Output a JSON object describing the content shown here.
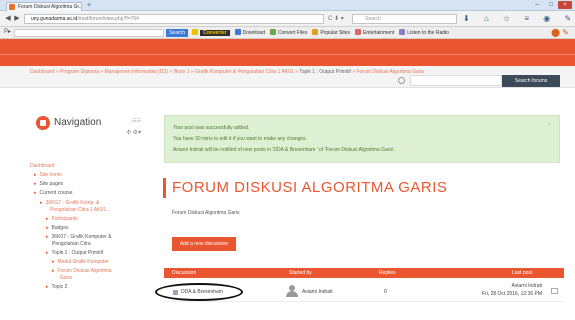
{
  "browser": {
    "tab_title": "Forum Diskusi Algoritma G...",
    "url_prefix": "uny.gunadarma.ac.id",
    "url_rest": "/mod/forum/view.php?f=764",
    "search_placeholder": "Search",
    "addon_search": "Search",
    "addon_items": [
      {
        "label": "Converter",
        "color": "#f2c200"
      },
      {
        "label": "Download",
        "color": "#3a7bd5"
      },
      {
        "label": "Convert Files",
        "color": "#6aa84f"
      },
      {
        "label": "Popular Sites",
        "color": "#e0a020"
      },
      {
        "label": "Entertainment",
        "color": "#e06666"
      },
      {
        "label": "Listen to the Radio",
        "color": "#8e7cc3"
      }
    ]
  },
  "breadcrumb": {
    "items": [
      "Dashboard",
      "Program Diploma",
      "Manajemen Informatika (D3)",
      "Ilkom 1",
      "Grafik Komputer & Pengolahan Citra 1 AK01"
    ],
    "current": "Topik 1 : Output Primitif",
    "tail": "Forum Diskusi Algoritma Garis"
  },
  "search_forums_button": "Search forums",
  "navigation": {
    "title": "Navigation",
    "tree": [
      {
        "label": "Dashboard",
        "style": "or",
        "bullet": false
      },
      {
        "label": "Site home",
        "style": "or",
        "bullet": true
      },
      {
        "label": "Site pages",
        "style": "gr",
        "bullet": true
      },
      {
        "label": "Current course",
        "style": "gr",
        "bullet": true
      },
      {
        "label": "36KG7 - Grafik Komp. &",
        "style": "or",
        "bullet": true
      },
      {
        "label": "Pengolahan Citra 1 AK01...",
        "style": "or",
        "bullet": false
      },
      {
        "label": "Participants",
        "style": "or",
        "bullet": true
      },
      {
        "label": "Badges",
        "style": "gr",
        "bullet": true
      },
      {
        "label": "36K07 - Grafik Komputer &",
        "style": "gr",
        "bullet": true
      },
      {
        "label": "Pengolahan Citra",
        "style": "gr",
        "bullet": false
      },
      {
        "label": "Topik 1 : Output Primitif",
        "style": "gr",
        "bullet": true
      },
      {
        "label": "Modul Grafik Komputer",
        "style": "or",
        "bullet": true
      },
      {
        "label": "Forum Diskusi Algoritma",
        "style": "or",
        "bullet": true
      },
      {
        "label": "Garis",
        "style": "or",
        "bullet": false
      },
      {
        "label": "Topic 2",
        "style": "gr",
        "bullet": true
      }
    ]
  },
  "alert": {
    "line1": "Your post was successfully added.",
    "line2": "You have 30 mins to edit it if you want to make any changes.",
    "line3": "Aviarni Indrati will be notified of new posts in 'DDA & Bresenham ' of 'Forum Diskusi Algoritma Garis'."
  },
  "forum": {
    "title": "FORUM DISKUSI ALGORITMA GARIS",
    "intro": "Forum Diskusi Algoritma Garis",
    "add_button": "Add a new discussion",
    "columns": [
      "Discussion",
      "Started by",
      "Replies",
      "Last post"
    ],
    "rows": [
      {
        "discussion": "DDA & Bresenham",
        "started_by": "Aviarni Indrati",
        "replies": "0",
        "last_post_user": "Aviarni Indrati",
        "last_post_date": "Fri, 28 Oct 2016, 12:36 PM"
      }
    ]
  }
}
